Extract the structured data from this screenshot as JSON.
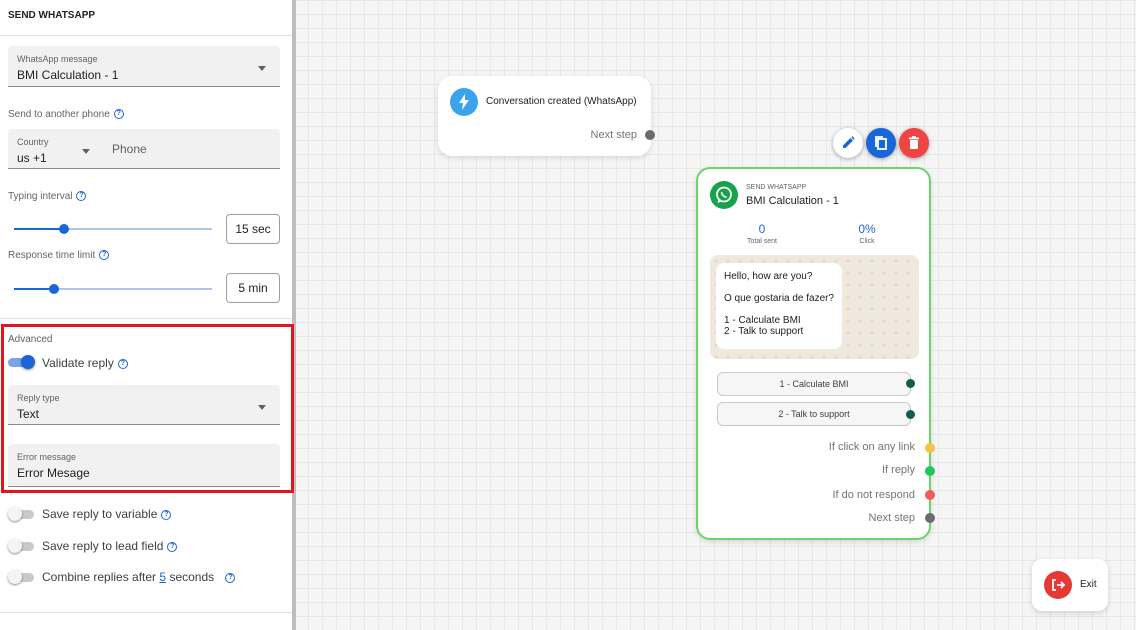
{
  "panel": {
    "title": "SEND WHATSAPP",
    "message_field": {
      "label": "WhatsApp message",
      "value": "BMI Calculation - 1"
    },
    "send_to_phone_label": "Send to another phone",
    "country_field": {
      "label": "Country",
      "value": "us +1"
    },
    "phone_placeholder": "Phone",
    "typing_interval": {
      "label": "Typing interval",
      "value": "15 sec",
      "level": 0.25
    },
    "response_limit": {
      "label": "Response time limit",
      "value": "5 min",
      "level": 0.2
    },
    "advanced": {
      "heading": "Advanced",
      "validate_reply_label": "Validate reply",
      "validate_reply_on": true,
      "reply_type_field": {
        "label": "Reply type",
        "value": "Text"
      },
      "error_field": {
        "label": "Error message",
        "value": "Error Mesage"
      }
    },
    "save_variable_label": "Save reply to variable",
    "save_lead_label": "Save reply to lead field",
    "combine_prefix": "Combine replies after",
    "combine_value": "5",
    "combine_suffix": "seconds",
    "help_glyph": "?"
  },
  "trigger_node": {
    "icon": "lightning-icon",
    "title": "Conversation created (WhatsApp)",
    "next_step": "Next step"
  },
  "node_actions": {
    "edit_icon": "pencil-icon",
    "copy_icon": "copy-icon",
    "delete_icon": "trash-icon"
  },
  "wa_node": {
    "kind": "SEND WHATSAPP",
    "title": "BMI Calculation - 1",
    "total_sent": "0",
    "total_sent_label": "Total sent",
    "click_rate": "0%",
    "click_label": "Click",
    "messages": [
      "Hello, how are you?",
      "O que gostaria de fazer?",
      "1 - Calculate BMI",
      "2 - Talk to support"
    ],
    "options": [
      "1 - Calculate BMI",
      "2 - Talk to support"
    ],
    "outputs": {
      "click_link": "If click on any link",
      "reply": "If reply",
      "no_response": "If do not respond",
      "next": "Next step"
    }
  },
  "exit_label": "Exit",
  "colors": {
    "accent": "#1a66d8",
    "whatsapp": "#17a34a",
    "delete": "#ef4444",
    "highlight": "#e0161d",
    "dot_yellow": "#f6c343",
    "dot_green": "#22c55e",
    "dot_red": "#f25c5c",
    "dot_gray": "#6b6b6b",
    "dot_teal": "#0f5e52"
  }
}
